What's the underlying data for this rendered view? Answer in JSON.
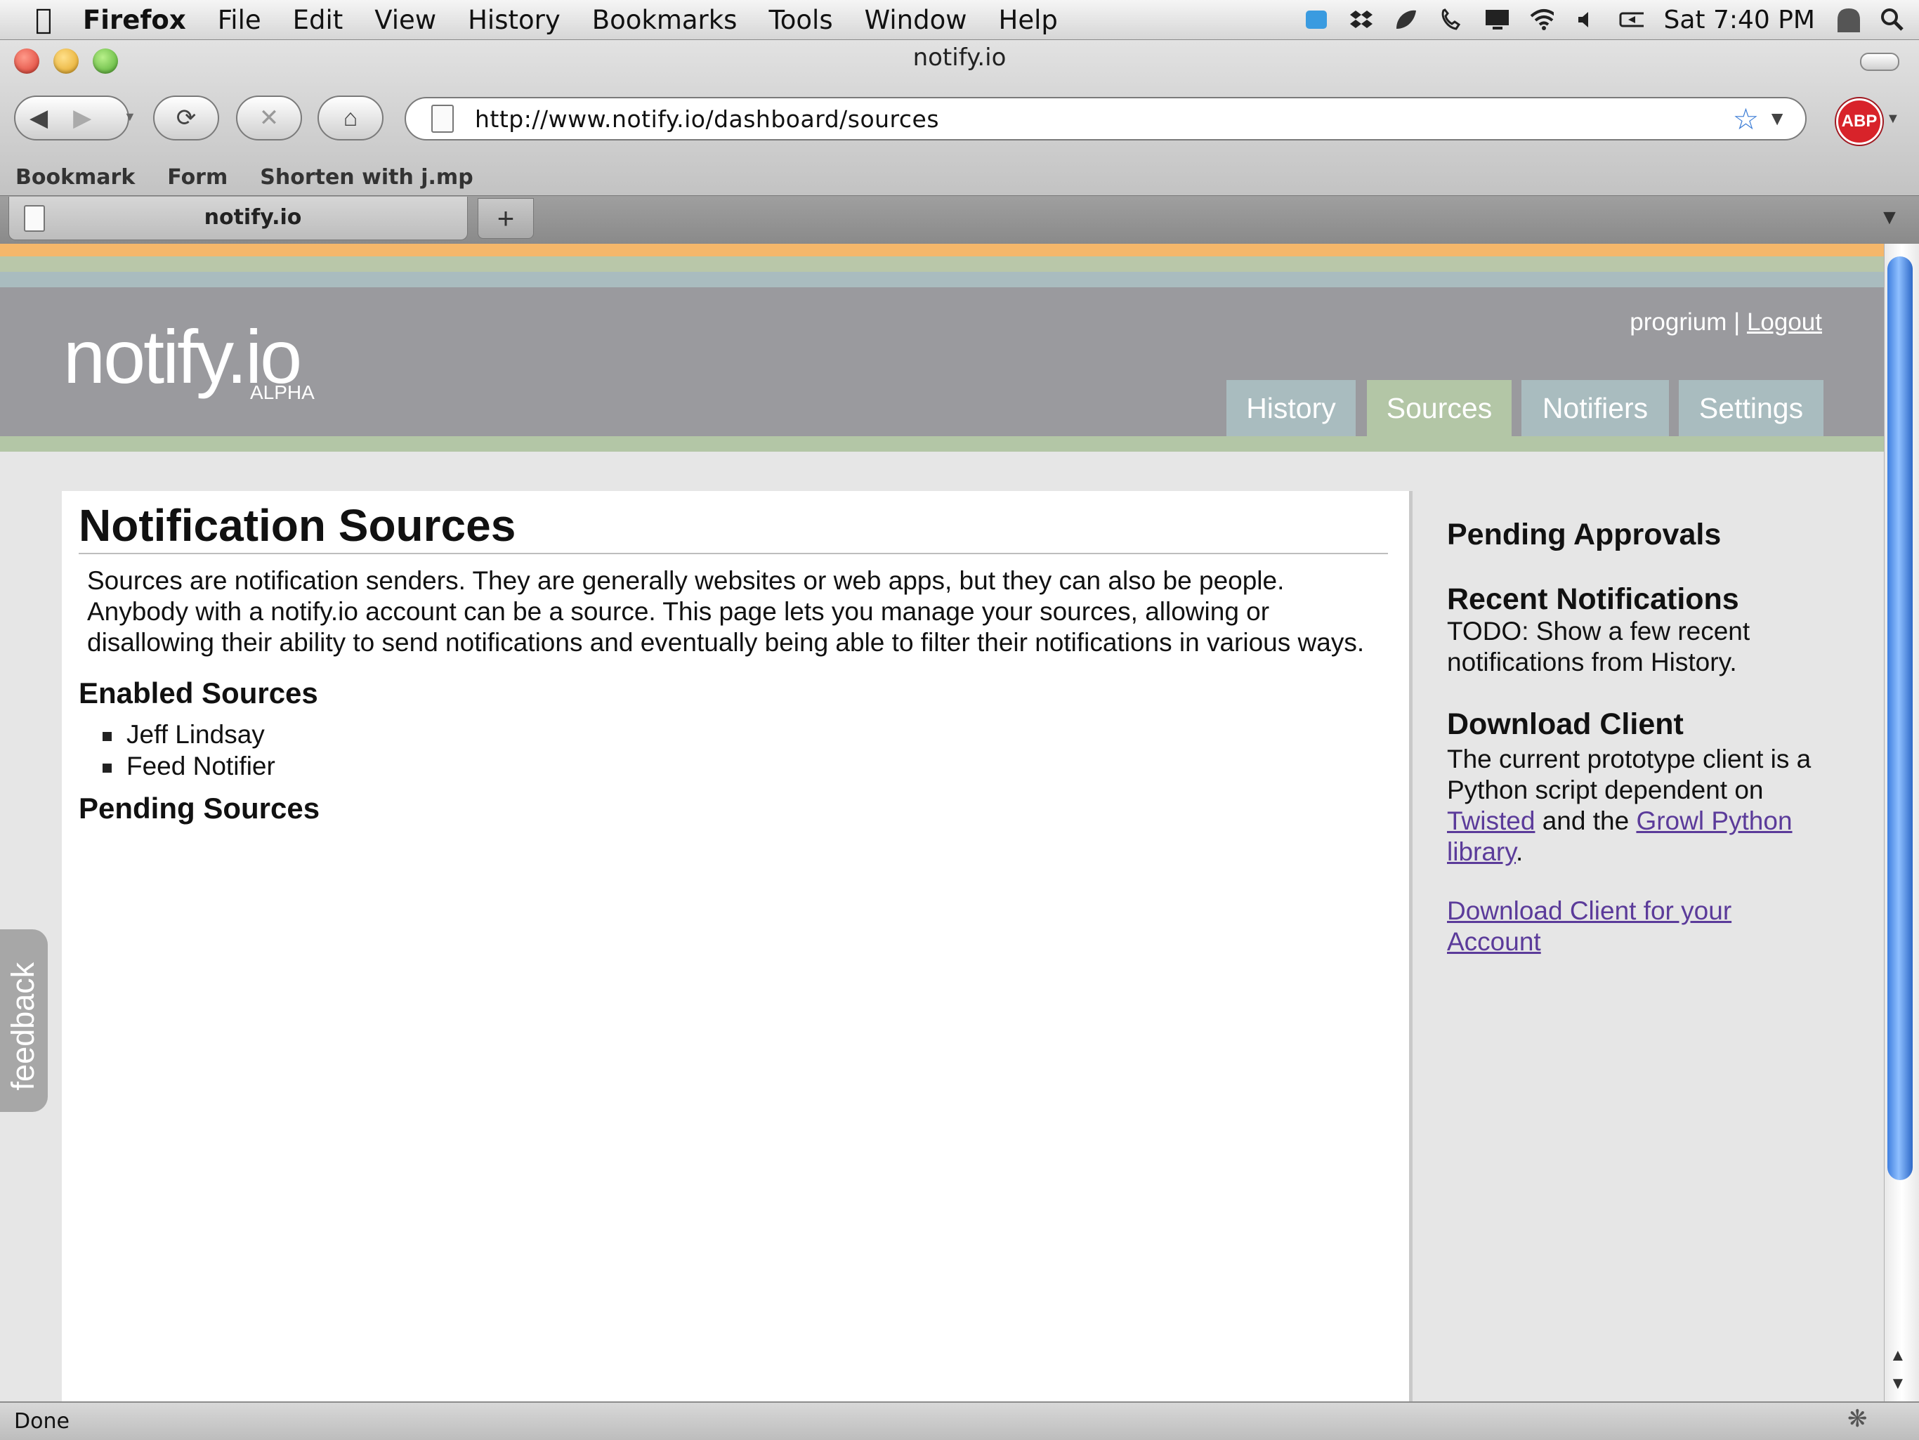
{
  "menubar": {
    "app_name": "Firefox",
    "items": [
      "File",
      "Edit",
      "View",
      "History",
      "Bookmarks",
      "Tools",
      "Window",
      "Help"
    ],
    "clock": "Sat 7:40 PM"
  },
  "window": {
    "title": "notify.io"
  },
  "toolbar": {
    "url": "http://www.notify.io/dashboard/sources",
    "addon_label": "ABP"
  },
  "bookmarks_bar": {
    "items": [
      "Bookmark",
      "Form",
      "Shorten with j.mp"
    ]
  },
  "tabs": {
    "active_label": "notify.io",
    "new_tab_label": "+"
  },
  "site": {
    "logo": "notify.io",
    "logo_badge": "ALPHA",
    "username": "progrium",
    "separator": "|",
    "logout": "Logout",
    "nav": [
      "History",
      "Sources",
      "Notifiers",
      "Settings"
    ],
    "active_nav": "Sources",
    "feedback": "feedback",
    "colors": {
      "stripe_orange": "#f5b76a",
      "stripe_green": "#b3c6a6",
      "stripe_teal": "#a9bcbf",
      "header_gray": "#9a9a9e",
      "link_purple": "#5b3b9a"
    }
  },
  "main": {
    "title": "Notification Sources",
    "intro_lines": [
      "Sources are notification senders. They are generally websites or web apps, but they can also be people.",
      "Anybody with a notify.io account can be a source. This page lets you manage your sources, allowing or",
      "disallowing their ability to send notifications and eventually being able to filter their notifications in various ways."
    ],
    "enabled_heading": "Enabled Sources",
    "enabled_sources": [
      "Jeff Lindsay",
      "Feed Notifier"
    ],
    "pending_heading": "Pending Sources"
  },
  "sidebar": {
    "pending_heading": "Pending Approvals",
    "recent_heading": "Recent Notifications",
    "recent_text": "TODO: Show a few recent notifications from History.",
    "download_heading": "Download Client",
    "download_text_1": "The current prototype client is a Python script dependent on",
    "link_twisted": "Twisted",
    "text_and_the": "and the",
    "link_growl": "Growl Python library",
    "text_period": ".",
    "download_link": "Download Client for your Account"
  },
  "statusbar": {
    "text": "Done"
  }
}
